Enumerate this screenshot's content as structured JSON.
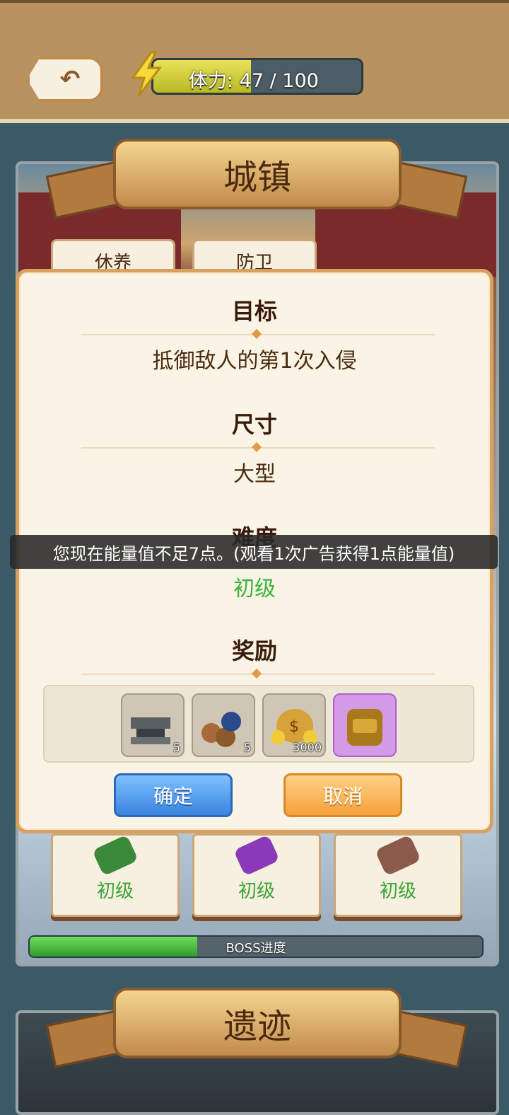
{
  "energy": {
    "label": "体力:",
    "current": 47,
    "max": 100,
    "text": "体力: 47 / 100",
    "fill_fraction": 0.47
  },
  "regions": [
    {
      "title": "城镇"
    },
    {
      "title": "遗迹"
    }
  ],
  "tabs": [
    {
      "label": "休养"
    },
    {
      "label": "防卫"
    }
  ],
  "dialog": {
    "sections": {
      "goal": {
        "title": "目标",
        "value": "抵御敌人的第1次入侵"
      },
      "size": {
        "title": "尺寸",
        "value": "大型"
      },
      "difficulty": {
        "title": "难度",
        "value": "初级"
      },
      "reward": {
        "title": "奖励"
      }
    },
    "rewards": [
      {
        "icon": "iron-beam-icon",
        "qty": "5"
      },
      {
        "icon": "wood-logs-icon",
        "qty": "5"
      },
      {
        "icon": "money-bag-icon",
        "qty": "3000"
      },
      {
        "icon": "backpack-icon",
        "qty": ""
      }
    ],
    "confirm": "确定",
    "cancel": "取消"
  },
  "toast": "您现在能量值不足7点。(观看1次广告获得1点能量值)",
  "levels": [
    {
      "label": "初级",
      "scroll_color": "#3a8a3a"
    },
    {
      "label": "初级",
      "scroll_color": "#8a3ab8"
    },
    {
      "label": "初级",
      "scroll_color": "#8a5a4a"
    }
  ],
  "boss": {
    "label": "BOSS进度",
    "progress_fraction": 0.37
  }
}
